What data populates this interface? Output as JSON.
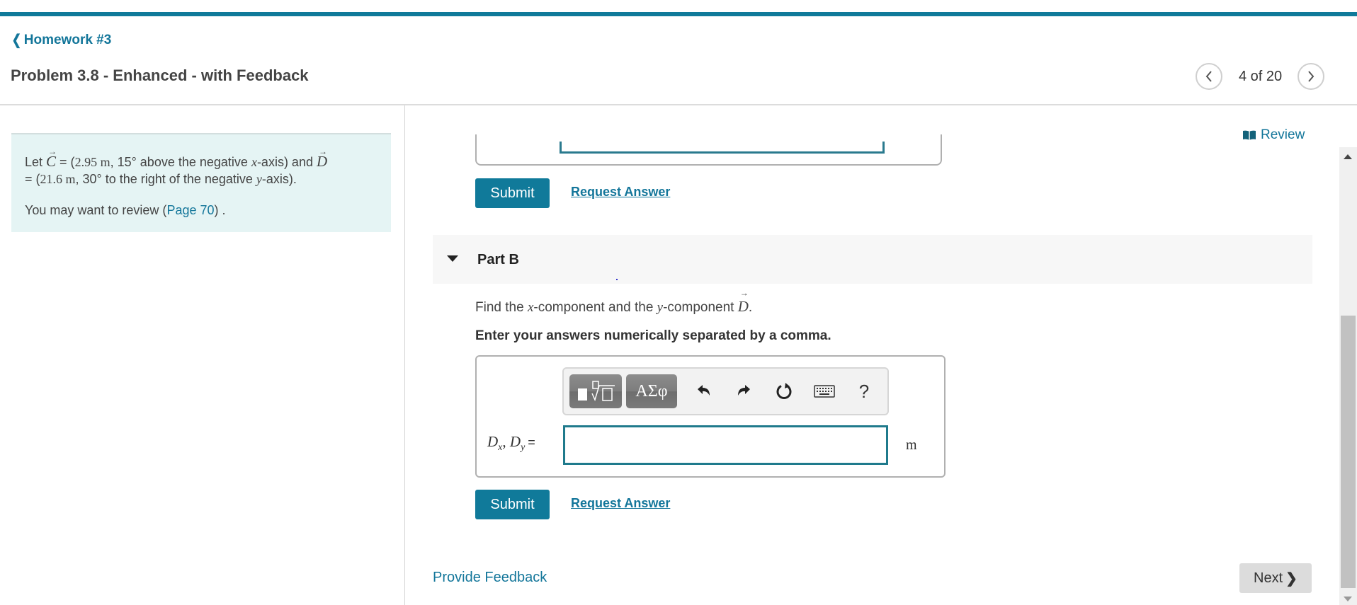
{
  "header": {
    "back_link": "Homework #3",
    "problem_title": "Problem 3.8 - Enhanced - with Feedback",
    "pager": {
      "current": 4,
      "total": 20,
      "text": "4 of 20"
    },
    "review_label": "Review"
  },
  "intro": {
    "line1_prefix": "Let ",
    "vector_c": "C",
    "c_eq": " = (",
    "c_magnitude": "2.95 m",
    "c_angle": ", 15° above the negative ",
    "c_axis_var": "x",
    "c_suffix": "-axis) and ",
    "vector_d": "D",
    "d_eq": " = (",
    "d_magnitude": "21.6 m",
    "d_angle": ", 30° to the right of the negative ",
    "d_axis_var": "y",
    "d_suffix": "-axis).",
    "review_prefix": "You may want to review (",
    "review_link": "Page 70",
    "review_suffix": ") ."
  },
  "part_a": {
    "submit_label": "Submit",
    "request_answer_label": "Request Answer"
  },
  "part_b": {
    "title": "Part B",
    "question_prefix": "Find the ",
    "question_x": "x",
    "question_mid": "-component and the ",
    "question_y": "y",
    "question_mid2": "-component ",
    "question_vector": "D",
    "question_suffix": ".",
    "instruction": "Enter your answers numerically separated by a comma.",
    "toolbar": {
      "templates_icon": "templates-sqrt-icon",
      "greek_label": "ΑΣφ",
      "undo_icon": "undo-icon",
      "redo_icon": "redo-icon",
      "reset_icon": "reset-icon",
      "keyboard_icon": "keyboard-icon",
      "help_label": "?"
    },
    "answer_label_d": "D",
    "answer_label_x": "x",
    "answer_label_sep": ", ",
    "answer_label_y": "y",
    "answer_label_eq": "=",
    "answer_value": "",
    "unit": "m",
    "submit_label": "Submit",
    "request_answer_label": "Request Answer"
  },
  "footer": {
    "feedback_label": "Provide Feedback",
    "next_label": "Next"
  },
  "colors": {
    "accent": "#107a9a",
    "link": "#13769a",
    "intro_bg": "#e5f4f4",
    "part_header_bg": "#f7f7f7",
    "next_bg": "#dcdcdc"
  }
}
